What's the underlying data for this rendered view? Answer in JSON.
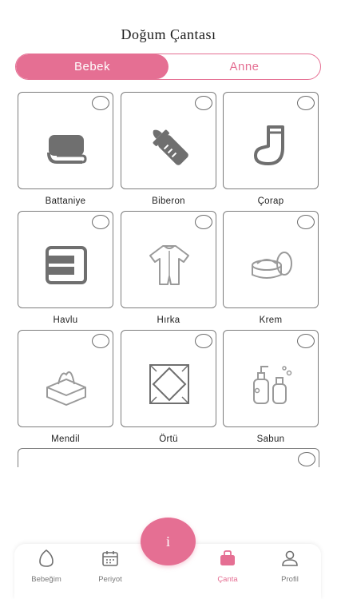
{
  "header": {
    "title": "Doğum Çantası"
  },
  "segment": {
    "active_label": "Bebek",
    "inactive_label": "Anne"
  },
  "items": [
    {
      "label": "Battaniye",
      "icon": "blanket-icon"
    },
    {
      "label": "Biberon",
      "icon": "baby-bottle-icon"
    },
    {
      "label": "Çorap",
      "icon": "sock-icon"
    },
    {
      "label": "Havlu",
      "icon": "towel-icon"
    },
    {
      "label": "Hırka",
      "icon": "baby-onesie-icon"
    },
    {
      "label": "Krem",
      "icon": "cream-jar-icon"
    },
    {
      "label": "Mendil",
      "icon": "tissue-box-icon"
    },
    {
      "label": "Örtü",
      "icon": "cover-icon"
    },
    {
      "label": "Sabun",
      "icon": "soap-bottles-icon"
    }
  ],
  "fab": {
    "label": "i"
  },
  "tabbar": {
    "tabs": [
      {
        "label": "Bebeğim",
        "icon": "egg-icon"
      },
      {
        "label": "Periyot",
        "icon": "calendar-icon"
      },
      {
        "label": "Çanta",
        "icon": "bag-icon",
        "active": true
      },
      {
        "label": "Profil",
        "icon": "user-icon"
      }
    ]
  },
  "colors": {
    "accent": "#e56f93",
    "icon_gray": "#6f6f6f"
  }
}
